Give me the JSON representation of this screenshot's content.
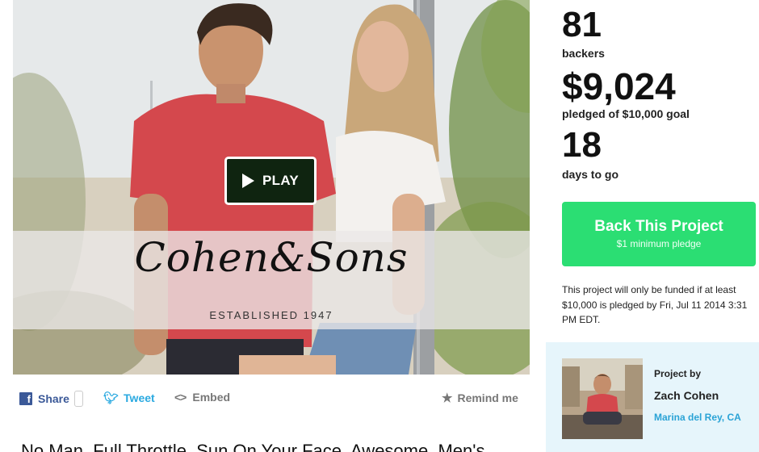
{
  "video": {
    "play_label": "PLAY",
    "brand_name": "Cohen&Sons",
    "brand_tagline": "ESTABLISHED 1947"
  },
  "share": {
    "facebook_label": "Share",
    "tweet_label": "Tweet",
    "embed_label": "Embed",
    "remind_label": "Remind me",
    "icons": {
      "facebook": "facebook-icon",
      "twitter": "twitter-icon",
      "embed": "embed-icon",
      "remind": "star-icon"
    }
  },
  "project": {
    "title": "No Man. Full Throttle. Sun On Your Face. Awesome. Men's"
  },
  "stats": {
    "backers_count": "81",
    "backers_label": "backers",
    "pledged_amount": "$9,024",
    "pledged_label": "pledged of $10,000 goal",
    "days_count": "18",
    "days_label": "days to go"
  },
  "cta": {
    "back_label": "Back This Project",
    "minimum_label": "$1 minimum pledge",
    "color": "#2bde73"
  },
  "funding_note": "This project will only be funded if at least $10,000 is pledged by Fri, Jul 11 2014 3:31 PM EDT.",
  "creator": {
    "project_by_label": "Project by",
    "name": "Zach Cohen",
    "location": "Marina del Rey, CA"
  },
  "colors": {
    "facebook": "#3b5998",
    "twitter": "#2aa9e0",
    "location_link": "#2aa3d6",
    "creator_box_bg": "#e6f5fb"
  }
}
